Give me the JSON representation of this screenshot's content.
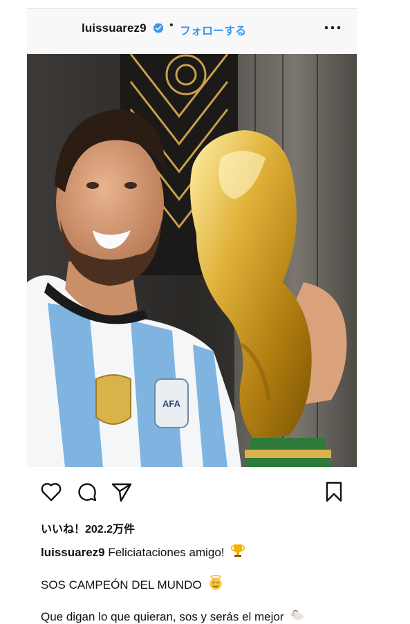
{
  "post": {
    "username": "luissuarez9",
    "separator": "•",
    "follow_label": "フォローする",
    "likes_text": "いいね！202.2万件",
    "caption_username": "luissuarez9",
    "caption_line1": "Feliciataciones amigo!",
    "caption_line2": "SOS CAMPEÓN DEL MUNDO",
    "caption_line3": "Que digan lo que quieran, sos y serás el mejor"
  },
  "icons": {
    "verified": "verified-badge-icon",
    "more": "more-options-icon",
    "like": "heart-icon",
    "comment": "comment-icon",
    "share": "send-icon",
    "save": "bookmark-icon",
    "trophy": "trophy-emoji",
    "halo": "halo-face-emoji",
    "goat": "goat-emoji"
  },
  "colors": {
    "accent": "#3897f0",
    "text": "#111111",
    "header_bg": "#f8f8f8"
  }
}
